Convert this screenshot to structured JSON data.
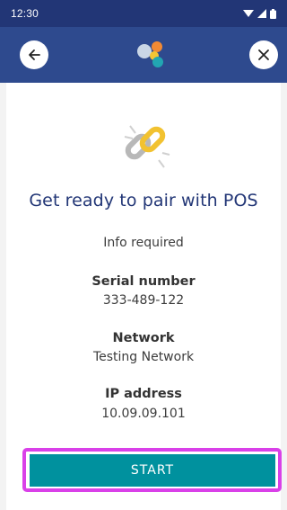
{
  "status_bar": {
    "time": "12:30",
    "icons": [
      "wifi-icon",
      "cellular-icon",
      "battery-icon"
    ]
  },
  "app_bar": {
    "back_icon": "arrow-left-icon",
    "close_icon": "close-icon",
    "logo_icon": "app-logo-icon",
    "colors": {
      "background": "#2e4a8e",
      "status": "#223676"
    }
  },
  "main": {
    "hero_icon": "chain-link-icon",
    "title": "Get ready to pair with POS",
    "info": "Info required",
    "fields": [
      {
        "label": "Serial number",
        "value": "333-489-122"
      },
      {
        "label": "Network",
        "value": "Testing Network"
      },
      {
        "label": "IP address",
        "value": "10.09.09.101"
      }
    ]
  },
  "actions": {
    "start_label": "START",
    "accent": "#00919e",
    "highlight": "#d940e8"
  }
}
